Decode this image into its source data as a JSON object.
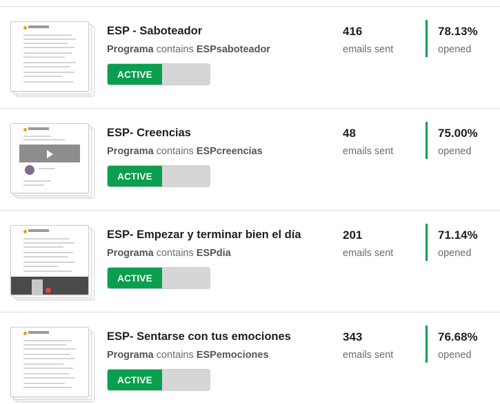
{
  "campaigns": [
    {
      "title": "ESP - Saboteador",
      "rule_field": "Programa",
      "rule_op": "contains",
      "rule_value": "ESPsaboteador",
      "status": "ACTIVE",
      "sent_count": "416",
      "sent_label": "emails sent",
      "open_rate": "78.13%",
      "open_label": "opened"
    },
    {
      "title": "ESP- Creencias",
      "rule_field": "Programa",
      "rule_op": "contains",
      "rule_value": "ESPcreencias",
      "status": "ACTIVE",
      "sent_count": "48",
      "sent_label": "emails sent",
      "open_rate": "75.00%",
      "open_label": "opened"
    },
    {
      "title": "ESP- Empezar y terminar bien el día",
      "rule_field": "Programa",
      "rule_op": "contains",
      "rule_value": "ESPdia",
      "status": "ACTIVE",
      "sent_count": "201",
      "sent_label": "emails sent",
      "open_rate": "71.14%",
      "open_label": "opened"
    },
    {
      "title": "ESP- Sentarse con tus emociones",
      "rule_field": "Programa",
      "rule_op": "contains",
      "rule_value": "ESPemociones",
      "status": "ACTIVE",
      "sent_count": "343",
      "sent_label": "emails sent",
      "open_rate": "76.68%",
      "open_label": "opened"
    }
  ],
  "colors": {
    "active_green": "#0b9e4f",
    "toggle_off": "#d6d6d6",
    "divider": "#dcdcdc"
  }
}
